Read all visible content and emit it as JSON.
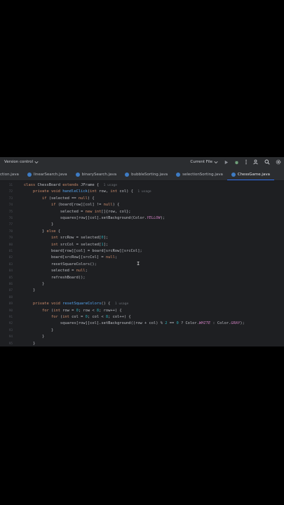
{
  "toolbar": {
    "version_control": "Version control",
    "current_file": "Current File"
  },
  "tabs": [
    {
      "label": "ction.java",
      "active": false
    },
    {
      "label": "linearSearch.java",
      "active": false
    },
    {
      "label": "binarySearch.java",
      "active": false
    },
    {
      "label": "bubbleSorting.java",
      "active": false
    },
    {
      "label": "selectionSorting.java",
      "active": false
    },
    {
      "label": "ChessGame.java",
      "active": true
    }
  ],
  "editor": {
    "lines": [
      {
        "n": "11",
        "tokens": [
          [
            "kw",
            "class "
          ],
          [
            "",
            "ChessBoard "
          ],
          [
            "kw",
            "extends "
          ],
          [
            "",
            "JFrame {  "
          ],
          [
            "hint",
            "1 usage"
          ]
        ]
      },
      {
        "n": "72",
        "tokens": [
          [
            "",
            "    "
          ],
          [
            "kw",
            "private void "
          ],
          [
            "fn",
            "handleClick"
          ],
          [
            "",
            "("
          ],
          [
            "kw",
            "int "
          ],
          [
            "",
            "row, "
          ],
          [
            "kw",
            "int "
          ],
          [
            "",
            "col) {  "
          ],
          [
            "hint",
            "1 usage"
          ]
        ]
      },
      {
        "n": "73",
        "tokens": [
          [
            "",
            "        "
          ],
          [
            "kw",
            "if "
          ],
          [
            "",
            "(selected == "
          ],
          [
            "kw",
            "null"
          ],
          [
            "",
            ") {"
          ]
        ]
      },
      {
        "n": "74",
        "tokens": [
          [
            "",
            "            "
          ],
          [
            "kw",
            "if "
          ],
          [
            "",
            "(board[row][col] != "
          ],
          [
            "kw",
            "null"
          ],
          [
            "",
            ") {"
          ]
        ]
      },
      {
        "n": "75",
        "tokens": [
          [
            "",
            "                selected = "
          ],
          [
            "kw",
            "new int"
          ],
          [
            "",
            "[]{row, col};"
          ]
        ]
      },
      {
        "n": "76",
        "tokens": [
          [
            "",
            "                squares[row][col].setBackground(Color."
          ],
          [
            "const",
            "YELLOW"
          ],
          [
            "",
            ");"
          ]
        ]
      },
      {
        "n": "77",
        "tokens": [
          [
            "",
            "            }"
          ]
        ]
      },
      {
        "n": "78",
        "tokens": [
          [
            "",
            "        } "
          ],
          [
            "kw",
            "else "
          ],
          [
            "",
            "{"
          ]
        ]
      },
      {
        "n": "79",
        "tokens": [
          [
            "",
            "            "
          ],
          [
            "kw",
            "int "
          ],
          [
            "",
            "srcRow = selected["
          ],
          [
            "num",
            "0"
          ],
          [
            "",
            "];"
          ]
        ]
      },
      {
        "n": "80",
        "tokens": [
          [
            "",
            "            "
          ],
          [
            "kw",
            "int "
          ],
          [
            "",
            "srcCol = selected["
          ],
          [
            "num",
            "1"
          ],
          [
            "",
            "];"
          ]
        ]
      },
      {
        "n": "81",
        "tokens": [
          [
            "",
            "            board[row][col] = board[srcRow][srcCol];"
          ]
        ]
      },
      {
        "n": "82",
        "tokens": [
          [
            "",
            "            board[srcRow][srcCol] = "
          ],
          [
            "kw",
            "null"
          ],
          [
            "",
            ";"
          ]
        ]
      },
      {
        "n": "83",
        "tokens": [
          [
            "",
            "            resetSquareColors();"
          ]
        ]
      },
      {
        "n": "84",
        "tokens": [
          [
            "",
            "            selected = "
          ],
          [
            "kw",
            "null"
          ],
          [
            "",
            ";"
          ]
        ]
      },
      {
        "n": "85",
        "tokens": [
          [
            "",
            "            refreshBoard();"
          ]
        ]
      },
      {
        "n": "86",
        "tokens": [
          [
            "",
            "        }"
          ]
        ]
      },
      {
        "n": "87",
        "tokens": [
          [
            "",
            "    }"
          ]
        ]
      },
      {
        "n": "88",
        "tokens": []
      },
      {
        "n": "89",
        "tokens": [
          [
            "",
            "    "
          ],
          [
            "kw",
            "private void "
          ],
          [
            "fn",
            "resetSquareColors"
          ],
          [
            "",
            "() {  "
          ],
          [
            "hint",
            "1 usage"
          ]
        ]
      },
      {
        "n": "90",
        "tokens": [
          [
            "",
            "        "
          ],
          [
            "kw",
            "for "
          ],
          [
            "",
            "("
          ],
          [
            "kw",
            "int "
          ],
          [
            "",
            "row = "
          ],
          [
            "num",
            "0"
          ],
          [
            "",
            "; row < "
          ],
          [
            "num",
            "8"
          ],
          [
            "",
            "; row++) {"
          ]
        ]
      },
      {
        "n": "91",
        "tokens": [
          [
            "",
            "            "
          ],
          [
            "kw",
            "for "
          ],
          [
            "",
            "("
          ],
          [
            "kw",
            "int "
          ],
          [
            "",
            "col = "
          ],
          [
            "num",
            "0"
          ],
          [
            "",
            "; col < "
          ],
          [
            "num",
            "8"
          ],
          [
            "",
            "; col++) {"
          ]
        ]
      },
      {
        "n": "92",
        "tokens": [
          [
            "",
            "                squares[row][col].setBackground((row + col) % "
          ],
          [
            "num",
            "2"
          ],
          [
            "",
            " == "
          ],
          [
            "num",
            "0"
          ],
          [
            "",
            " ? Color."
          ],
          [
            "const",
            "WHITE"
          ],
          [
            "",
            " : Color."
          ],
          [
            "const",
            "GRAY"
          ],
          [
            "",
            ");"
          ]
        ]
      },
      {
        "n": "93",
        "tokens": [
          [
            "",
            "            }"
          ]
        ]
      },
      {
        "n": "94",
        "tokens": [
          [
            "",
            "        }"
          ]
        ]
      },
      {
        "n": "95",
        "tokens": [
          [
            "",
            "    }"
          ]
        ]
      }
    ]
  },
  "colors": {
    "background": "#1e1f22",
    "toolbar": "#2b2d30",
    "accent": "#3574f0",
    "keyword": "#cf8e6d",
    "method": "#56a8f5",
    "number": "#2aacb8",
    "constant": "#c77dbb"
  }
}
